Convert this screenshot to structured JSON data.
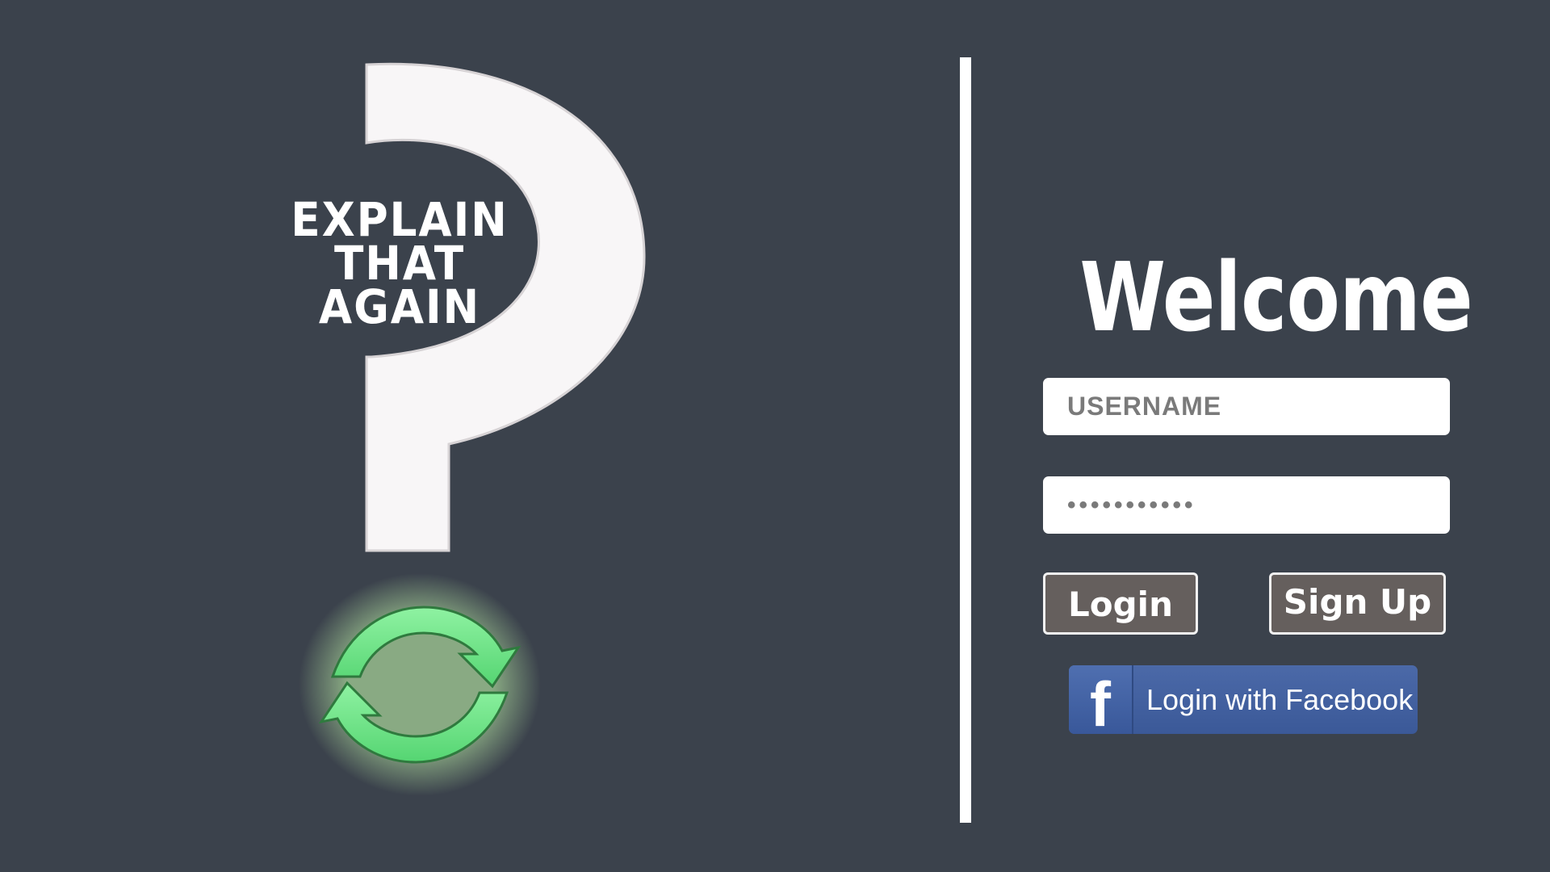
{
  "logo": {
    "line1": "EXPLAIN",
    "line2": "THAT",
    "line3": "AGAIN"
  },
  "login_form": {
    "title": "Welcome",
    "username": {
      "placeholder": "USERNAME",
      "value": ""
    },
    "password": {
      "value": "•••••••••••"
    },
    "login_label": "Login",
    "signup_label": "Sign Up",
    "facebook": {
      "icon_glyph": "f",
      "label": "Login with Facebook"
    }
  },
  "icons": {
    "logo_mark": "question-mark-icon",
    "refresh": "refresh-icon",
    "facebook": "facebook-icon"
  },
  "colors": {
    "background": "#3b424c",
    "button_fill": "#655f5d",
    "facebook_blue": "#3b5998",
    "refresh_green": "#6fe58a"
  }
}
